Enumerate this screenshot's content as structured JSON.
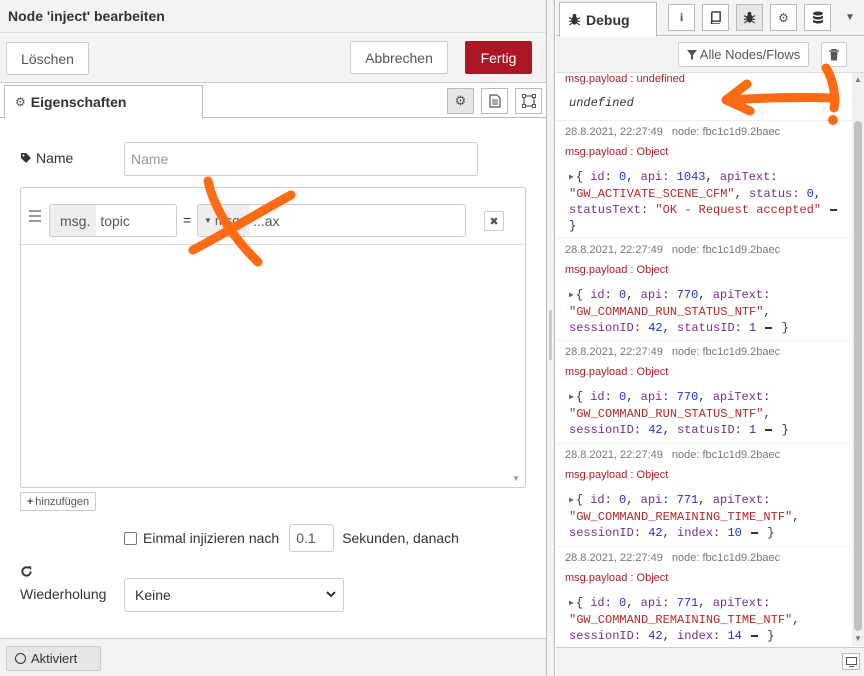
{
  "tray": {
    "title": "Node 'inject' bearbeiten",
    "delete_label": "Löschen",
    "cancel_label": "Abbrechen",
    "done_label": "Fertig",
    "tab_properties": "Eigenschaften",
    "name_label": "Name",
    "name_placeholder": "Name",
    "property": {
      "key_prefix": "msg.",
      "key_value": "topic",
      "equals": "=",
      "value_prefix": "msg.",
      "value_value": "...ax"
    },
    "add_label": "hinzufügen",
    "once_label": "Einmal injizieren nach",
    "once_delay": "0.1",
    "once_suffix": "Sekunden, danach",
    "repeat_label": "Wiederholung",
    "repeat_value": "Keine",
    "active_label": "Aktiviert"
  },
  "sidebar": {
    "tab_debug": "Debug",
    "filter_label": "Alle Nodes/Flows",
    "partial": {
      "topic": "msg.payload : undefined",
      "payload": "undefined"
    },
    "messages": [
      {
        "date": "28.8.2021, 22:27:49",
        "node": "node: fbc1c1d9.2baec",
        "topic": "msg.payload : Object",
        "id": "0",
        "api": "1043",
        "apiText": "\"GW_ACTIVATE_SCENE_CFM\"",
        "k3": "status",
        "v3": "0",
        "k4": "statusText",
        "v4": "\"OK - Request accepted\""
      },
      {
        "date": "28.8.2021, 22:27:49",
        "node": "node: fbc1c1d9.2baec",
        "topic": "msg.payload : Object",
        "id": "0",
        "api": "770",
        "apiText": "\"GW_COMMAND_RUN_STATUS_NTF\"",
        "k3": "sessionID",
        "v3": "42",
        "k4": "statusID",
        "v4": "1"
      },
      {
        "date": "28.8.2021, 22:27:49",
        "node": "node: fbc1c1d9.2baec",
        "topic": "msg.payload : Object",
        "id": "0",
        "api": "770",
        "apiText": "\"GW_COMMAND_RUN_STATUS_NTF\"",
        "k3": "sessionID",
        "v3": "42",
        "k4": "statusID",
        "v4": "1"
      },
      {
        "date": "28.8.2021, 22:27:49",
        "node": "node: fbc1c1d9.2baec",
        "topic": "msg.payload : Object",
        "id": "0",
        "api": "771",
        "apiText": "\"GW_COMMAND_REMAINING_TIME_NTF\"",
        "k3": "sessionID",
        "v3": "42",
        "k4": "index",
        "v4": "10"
      },
      {
        "date": "28.8.2021, 22:27:49",
        "node": "node: fbc1c1d9.2baec",
        "topic": "msg.payload : Object",
        "id": "0",
        "api": "771",
        "apiText": "\"GW_COMMAND_REMAINING_TIME_NTF\"",
        "k3": "sessionID",
        "v3": "42",
        "k4": "index",
        "v4": "14"
      }
    ]
  },
  "colors": {
    "accent": "#ad1625",
    "annotation": "#ff6a13",
    "topic": "#aa1f2b"
  },
  "icons": [
    "gear-icon",
    "document-icon",
    "frame-icon",
    "tag-icon",
    "hamburger-icon",
    "close-icon",
    "plus-icon",
    "refresh-icon",
    "chevron-down-icon",
    "bug-icon",
    "info-icon",
    "book-icon",
    "database-icon",
    "filter-icon",
    "trash-icon",
    "triangle-right-icon",
    "popout-icon"
  ]
}
